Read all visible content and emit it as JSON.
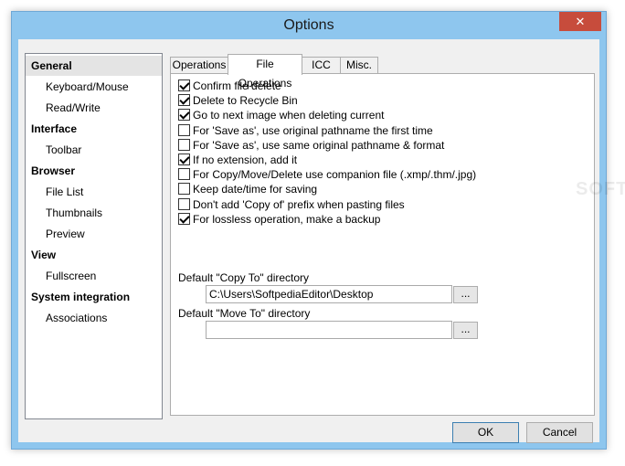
{
  "window": {
    "title": "Options",
    "close_glyph": "✕"
  },
  "sidebar": {
    "items": [
      {
        "label": "General",
        "kind": "category",
        "selected": true
      },
      {
        "label": "Keyboard/Mouse",
        "kind": "sub"
      },
      {
        "label": "Read/Write",
        "kind": "sub"
      },
      {
        "label": "Interface",
        "kind": "category"
      },
      {
        "label": "Toolbar",
        "kind": "sub"
      },
      {
        "label": "Browser",
        "kind": "category"
      },
      {
        "label": "File List",
        "kind": "sub"
      },
      {
        "label": "Thumbnails",
        "kind": "sub"
      },
      {
        "label": "Preview",
        "kind": "sub"
      },
      {
        "label": "View",
        "kind": "category"
      },
      {
        "label": "Fullscreen",
        "kind": "sub"
      },
      {
        "label": "System integration",
        "kind": "category"
      },
      {
        "label": "Associations",
        "kind": "sub"
      }
    ]
  },
  "tabs": [
    {
      "label": "Operations",
      "active": false
    },
    {
      "label": "File Operations",
      "active": true
    },
    {
      "label": "ICC",
      "active": false
    },
    {
      "label": "Misc.",
      "active": false
    }
  ],
  "options": [
    {
      "label": "Confirm file delete",
      "checked": true
    },
    {
      "label": "Delete to Recycle Bin",
      "checked": true
    },
    {
      "label": "Go to next image when deleting current",
      "checked": true
    },
    {
      "label": "For 'Save as', use original pathname the first time",
      "checked": false
    },
    {
      "label": "For 'Save as', use same original pathname & format",
      "checked": false
    },
    {
      "label": "If no extension, add it",
      "checked": true
    },
    {
      "label": "For Copy/Move/Delete use companion file (.xmp/.thm/.jpg)",
      "checked": false
    },
    {
      "label": "Keep date/time for saving",
      "checked": false
    },
    {
      "label": "Don't add 'Copy of' prefix when pasting files",
      "checked": false
    },
    {
      "label": "For lossless operation, make a backup",
      "checked": true
    }
  ],
  "copy_to": {
    "label": "Default \"Copy To\" directory",
    "value": "C:\\Users\\SoftpediaEditor\\Desktop",
    "browse": "..."
  },
  "move_to": {
    "label": "Default \"Move To\" directory",
    "value": "",
    "browse": "..."
  },
  "buttons": {
    "ok": "OK",
    "cancel": "Cancel"
  },
  "watermark": "SOFTPEDIA"
}
